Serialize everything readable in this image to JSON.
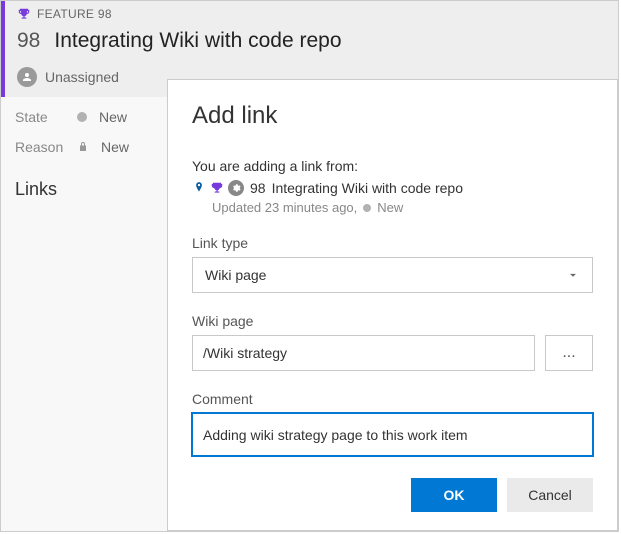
{
  "workItem": {
    "typeLabel": "FEATURE 98",
    "id": "98",
    "title": "Integrating Wiki with code repo",
    "assignedTo": "Unassigned",
    "state": {
      "label": "State",
      "value": "New"
    },
    "reason": {
      "label": "Reason",
      "value": "New"
    }
  },
  "sidebar": {
    "linksHeading": "Links"
  },
  "dialog": {
    "title": "Add link",
    "lead": "You are adding a link from:",
    "sourceId": "98",
    "sourceTitle": "Integrating Wiki with code repo",
    "updatedText": "Updated 23 minutes ago,",
    "sourceState": "New",
    "linkTypeLabel": "Link type",
    "linkTypeValue": "Wiki page",
    "wikiPageLabel": "Wiki page",
    "wikiPageValue": "/Wiki strategy",
    "browseLabel": "...",
    "commentLabel": "Comment",
    "commentValue": "Adding wiki strategy page to this work item",
    "okLabel": "OK",
    "cancelLabel": "Cancel"
  },
  "colors": {
    "accent": "#773adc",
    "primary": "#0078d4"
  }
}
